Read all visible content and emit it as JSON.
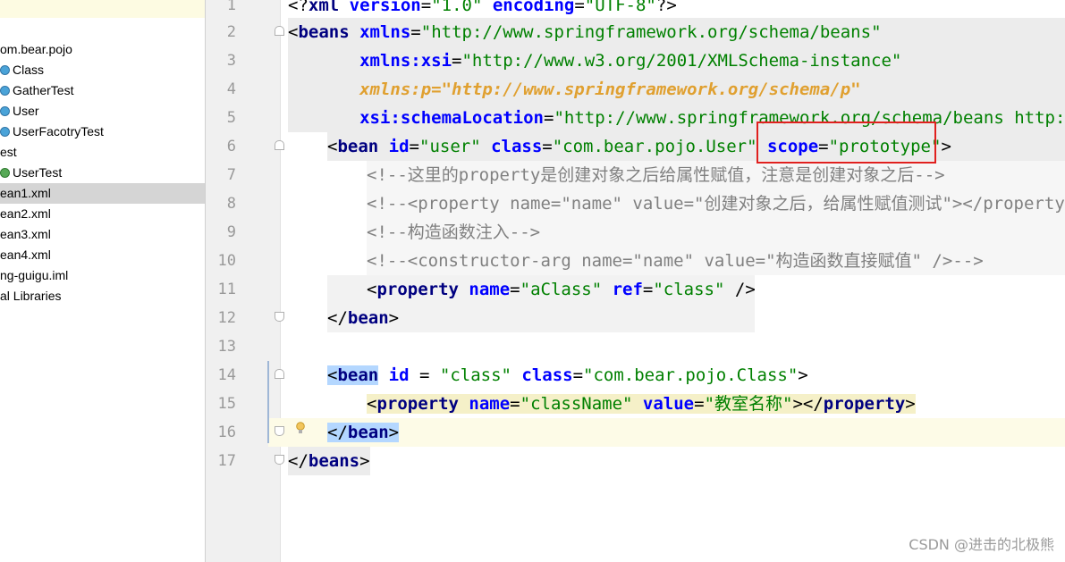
{
  "tree": {
    "items": [
      {
        "label": "om.bear.pojo",
        "icon": "package",
        "indent": 0
      },
      {
        "label": "Class",
        "icon": "class-icon",
        "indent": 1
      },
      {
        "label": "GatherTest",
        "icon": "class-icon",
        "indent": 1
      },
      {
        "label": "User",
        "icon": "class-icon",
        "indent": 1
      },
      {
        "label": "UserFacotryTest",
        "icon": "class-icon",
        "indent": 1
      },
      {
        "label": "est",
        "icon": "none",
        "indent": 0
      },
      {
        "label": "UserTest",
        "icon": "test-icon",
        "indent": 1
      },
      {
        "label": "ean1.xml",
        "icon": "none",
        "indent": 0,
        "selected": true
      },
      {
        "label": "ean2.xml",
        "icon": "none",
        "indent": 0
      },
      {
        "label": "ean3.xml",
        "icon": "none",
        "indent": 0
      },
      {
        "label": "ean4.xml",
        "icon": "none",
        "indent": 0
      },
      {
        "label": "ng-guigu.iml",
        "icon": "none",
        "indent": 0
      },
      {
        "label": "al Libraries",
        "icon": "none",
        "indent": 0
      }
    ]
  },
  "editor": {
    "line_numbers": [
      "1",
      "2",
      "3",
      "4",
      "5",
      "6",
      "7",
      "8",
      "9",
      "10",
      "11",
      "12",
      "13",
      "14",
      "15",
      "16",
      "17"
    ],
    "l1": {
      "a": "<?",
      "b": "xml",
      "c": " version",
      "d": "=",
      "e": "\"1.0\"",
      "f": " encoding",
      "g": "=",
      "h": "\"UTF-8\"",
      "i": "?>"
    },
    "l2": {
      "a": "<",
      "b": "beans",
      "c": " xmlns",
      "d": "=",
      "e": "\"http://www.springframework.org/schema/beans\""
    },
    "l3": {
      "a": "       xmlns:xsi",
      "b": "=",
      "c": "\"http://www.w3.org/2001/XMLSchema-instance\""
    },
    "l4": {
      "a": "       xmlns:p=\"http://www.springframework.org/schema/p\""
    },
    "l5": {
      "a": "       xsi:schemaLocation",
      "b": "=",
      "c": "\"http://www.springframework.org/schema/beans http://"
    },
    "l6": {
      "a": "<",
      "b": "bean",
      "c": " id",
      "d": "=",
      "e": "\"user\"",
      "f": " class",
      "g": "=",
      "h": "\"com.bear.pojo.User\"",
      "i": " scope",
      "j": "=",
      "k": "\"prototype\"",
      "l": ">"
    },
    "l7": {
      "a": "<!--这里的property是创建对象之后给属性赋值，注意是创建对象之后-->"
    },
    "l8": {
      "a": "<!--<property name=\"name\" value=\"创建对象之后，给属性赋值测试\"></property"
    },
    "l9": {
      "a": "<!--构造函数注入-->"
    },
    "l10": {
      "a": "<!--<constructor-arg name=\"name\" value=\"构造函数直接赋值\" />-->"
    },
    "l11": {
      "a": "<",
      "b": "property",
      "c": " name",
      "d": "=",
      "e": "\"aClass\"",
      "f": " ref",
      "g": "=",
      "h": "\"class\"",
      "i": " />"
    },
    "l12": {
      "a": "</",
      "b": "bean",
      "c": ">"
    },
    "l14": {
      "a": "<",
      "b": "bean",
      "c": " id",
      "d": " = ",
      "e": "\"class\"",
      "f": " class",
      "g": "=",
      "h": "\"com.bear.pojo.Class\"",
      "i": ">"
    },
    "l15": {
      "a": "<",
      "b": "property",
      "c": " name",
      "d": "=",
      "e": "\"className\"",
      "f": " value",
      "g": "=",
      "h": "\"教室名称\"",
      "i": "></",
      "j": "property",
      "k": ">"
    },
    "l16": {
      "a": "</",
      "b": "bean",
      "c": ">"
    },
    "l17": {
      "a": "</",
      "b": "beans",
      "c": ">"
    }
  },
  "watermark": "CSDN @进击的北极熊"
}
